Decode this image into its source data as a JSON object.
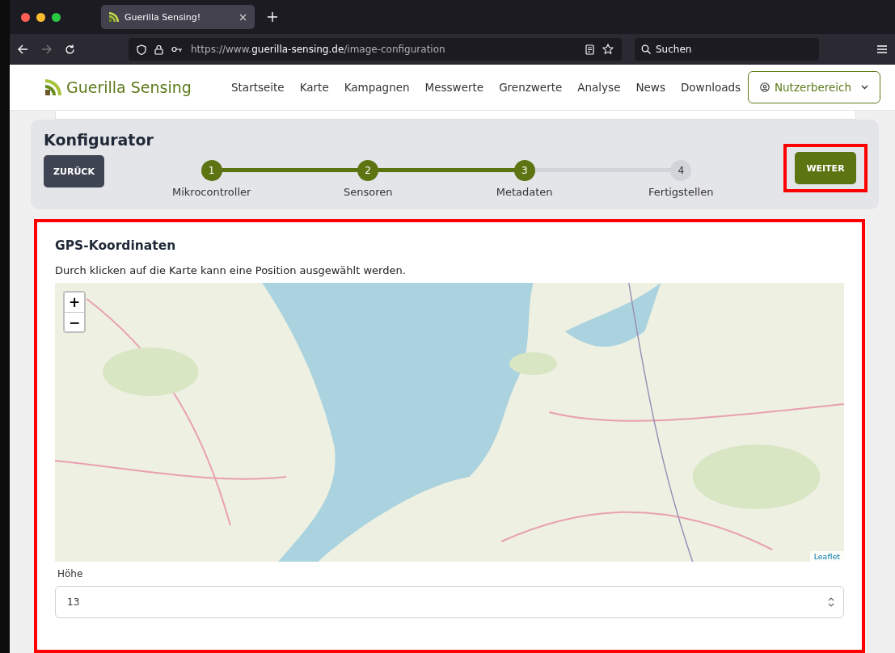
{
  "browser": {
    "tab_title": "Guerilla Sensing!",
    "url": "https://www.**guerilla-sensing.de**/image-configuration",
    "search_placeholder": "Suchen"
  },
  "header": {
    "logo_text": "Guerilla Sensing",
    "nav": [
      "Startseite",
      "Karte",
      "Kampagnen",
      "Messwerte",
      "Grenzwerte",
      "Analyse",
      "News",
      "Downloads"
    ],
    "user_button": "Nutzerbereich"
  },
  "configurator": {
    "title": "Konfigurator",
    "back_button": "ZURÜCK",
    "next_button": {
      "label": "WEITER",
      "highlighted": true
    },
    "steps": [
      {
        "number": "1",
        "label": "Mikrocontroller",
        "active": true
      },
      {
        "number": "2",
        "label": "Sensoren",
        "active": true
      },
      {
        "number": "3",
        "label": "Metadaten",
        "active": true
      },
      {
        "number": "4",
        "label": "Fertigstellen",
        "active": false
      }
    ]
  },
  "gps_card": {
    "highlighted": true,
    "title": "GPS-Koordinaten",
    "hint": "Durch klicken auf die Karte kann eine Position ausgewählt werden.",
    "map": {
      "kind": "picture",
      "zoom_in": "+",
      "zoom_out": "−",
      "attribution": "Leaflet"
    },
    "height_label": "Höhe",
    "height_value": "13"
  }
}
